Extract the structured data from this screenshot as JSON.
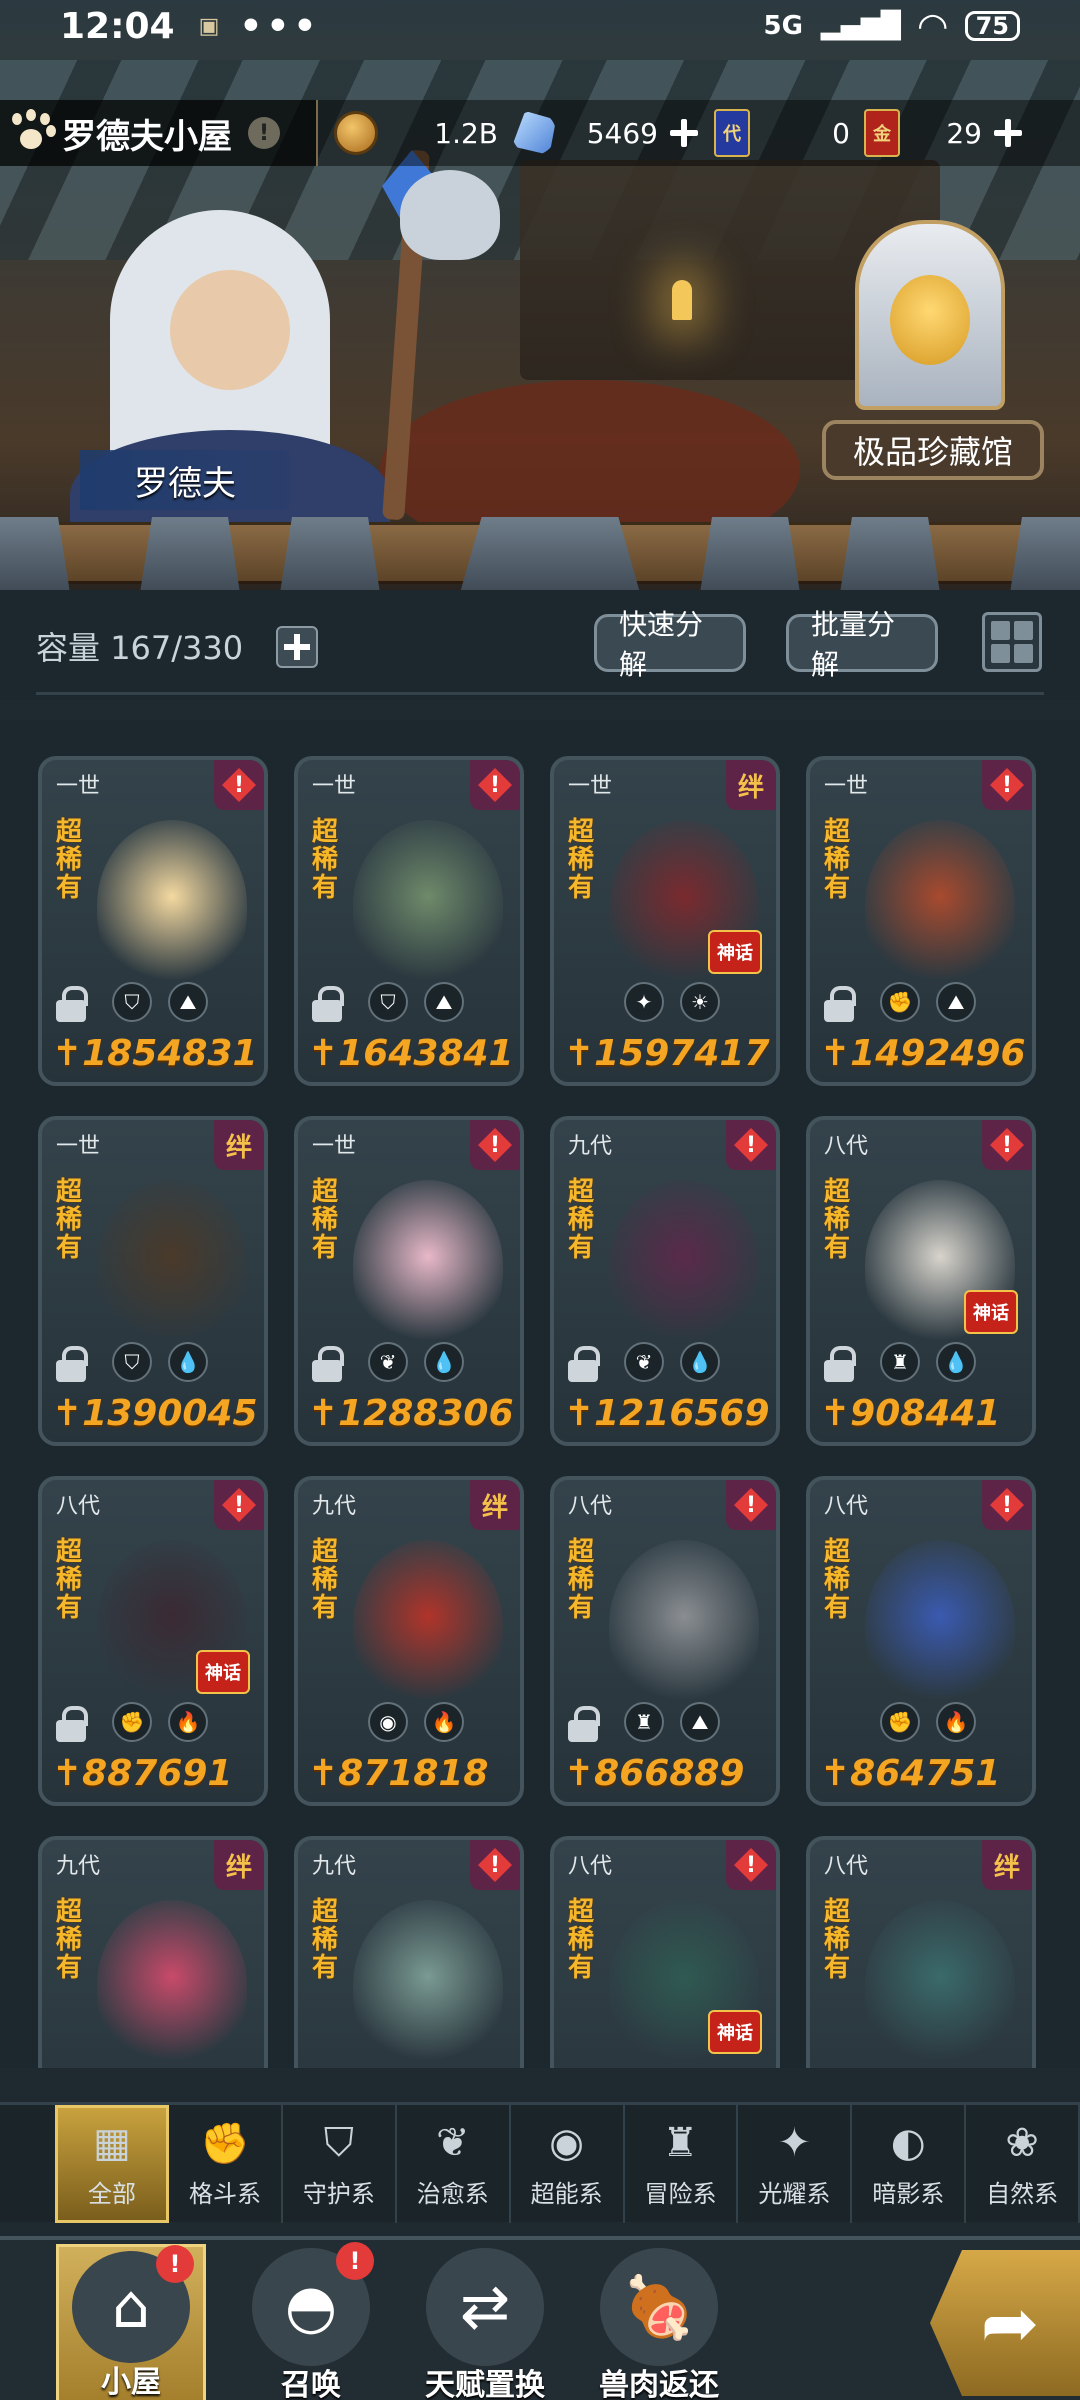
{
  "status_bar": {
    "time": "12:04",
    "notif": "▣",
    "dots": "•••",
    "network": "5G",
    "signal": "▂▄▆█",
    "wifi": "◠",
    "battery": "75"
  },
  "scene": {
    "npc_name": "罗德夫",
    "museum_label": "极品珍藏馆"
  },
  "header": {
    "title": "罗德夫小屋",
    "info_mark": "!",
    "gold": "1.2B",
    "crystals": "5469",
    "card_blue_mark": "代",
    "card_blue_value": "0",
    "card_red_mark": "金",
    "card_red_value": "29"
  },
  "storage": {
    "capacity_label": "容量",
    "capacity_value": "167/330",
    "quick_decompose": "快速分解",
    "batch_decompose": "批量分解"
  },
  "cards": [
    {
      "gen": "一世",
      "rarity": "超稀有",
      "badge": "alert",
      "power": "1854831",
      "icons": [
        "shield",
        "terrain"
      ],
      "locked": true,
      "myth": false,
      "color": "#f4d9a0"
    },
    {
      "gen": "一世",
      "rarity": "超稀有",
      "badge": "alert",
      "power": "1643841",
      "icons": [
        "guard",
        "terrain"
      ],
      "locked": true,
      "myth": false,
      "color": "#6f8a6a"
    },
    {
      "gen": "一世",
      "rarity": "超稀有",
      "badge": "bond",
      "power": "1597417",
      "icons": [
        "radiant",
        "sun"
      ],
      "locked": false,
      "myth": true,
      "color": "#7a2a2e"
    },
    {
      "gen": "一世",
      "rarity": "超稀有",
      "badge": "alert",
      "power": "1492496",
      "icons": [
        "fist",
        "terrain"
      ],
      "locked": true,
      "myth": false,
      "color": "#a84a2e"
    },
    {
      "gen": "一世",
      "rarity": "超稀有",
      "badge": "bond",
      "power": "1390045",
      "icons": [
        "guard",
        "water"
      ],
      "locked": true,
      "myth": false,
      "color": "#4a3a2a"
    },
    {
      "gen": "一世",
      "rarity": "超稀有",
      "badge": "alert",
      "power": "1288306",
      "icons": [
        "leaf",
        "water"
      ],
      "locked": true,
      "myth": false,
      "color": "#e8b8c8"
    },
    {
      "gen": "九代",
      "rarity": "超稀有",
      "badge": "alert",
      "power": "1216569",
      "icons": [
        "leaf",
        "water"
      ],
      "locked": true,
      "myth": false,
      "color": "#5a2a4a"
    },
    {
      "gen": "八代",
      "rarity": "超稀有",
      "badge": "alert",
      "power": "908441",
      "icons": [
        "adventure",
        "water"
      ],
      "locked": true,
      "myth": true,
      "color": "#d8d4cc"
    },
    {
      "gen": "八代",
      "rarity": "超稀有",
      "badge": "alert",
      "power": "887691",
      "icons": [
        "fist",
        "fire"
      ],
      "locked": true,
      "myth": true,
      "color": "#3a2a34"
    },
    {
      "gen": "九代",
      "rarity": "超稀有",
      "badge": "bond",
      "power": "871818",
      "icons": [
        "psychic",
        "fire"
      ],
      "locked": false,
      "myth": false,
      "color": "#b0342a"
    },
    {
      "gen": "八代",
      "rarity": "超稀有",
      "badge": "alert",
      "power": "866889",
      "icons": [
        "adventure",
        "terrain"
      ],
      "locked": true,
      "myth": false,
      "color": "#8a8e92"
    },
    {
      "gen": "八代",
      "rarity": "超稀有",
      "badge": "alert",
      "power": "864751",
      "icons": [
        "fist",
        "fire"
      ],
      "locked": false,
      "myth": false,
      "color": "#3a5ab0"
    },
    {
      "gen": "九代",
      "rarity": "超稀有",
      "badge": "bond",
      "power": "",
      "icons": [],
      "locked": false,
      "myth": false,
      "color": "#c84a6a"
    },
    {
      "gen": "九代",
      "rarity": "超稀有",
      "badge": "alert",
      "power": "",
      "icons": [],
      "locked": false,
      "myth": false,
      "color": "#7a9a92"
    },
    {
      "gen": "八代",
      "rarity": "超稀有",
      "badge": "alert",
      "power": "",
      "icons": [],
      "locked": false,
      "myth": true,
      "color": "#2f5a52"
    },
    {
      "gen": "八代",
      "rarity": "超稀有",
      "badge": "bond",
      "power": "",
      "icons": [],
      "locked": false,
      "myth": false,
      "color": "#3a6a6a"
    }
  ],
  "card_labels": {
    "bond": "绊",
    "alert": "!",
    "myth": "神话",
    "power_prefix": "✝"
  },
  "categories": [
    {
      "label": "全部",
      "icon": "▦"
    },
    {
      "label": "格斗系",
      "icon": "✊"
    },
    {
      "label": "守护系",
      "icon": "⛉"
    },
    {
      "label": "治愈系",
      "icon": "❦"
    },
    {
      "label": "超能系",
      "icon": "◉"
    },
    {
      "label": "冒险系",
      "icon": "♜"
    },
    {
      "label": "光耀系",
      "icon": "✦"
    },
    {
      "label": "暗影系",
      "icon": "◐"
    },
    {
      "label": "自然系",
      "icon": "❀"
    }
  ],
  "bottom_nav": [
    {
      "label": "小屋",
      "icon": "⌂",
      "alert": "!"
    },
    {
      "label": "召唤",
      "icon": "◓",
      "alert": "!"
    },
    {
      "label": "天赋置换",
      "icon": "⇄",
      "alert": ""
    },
    {
      "label": "兽肉返还",
      "icon": "🍖",
      "alert": ""
    }
  ],
  "go_button_icon": "➦"
}
